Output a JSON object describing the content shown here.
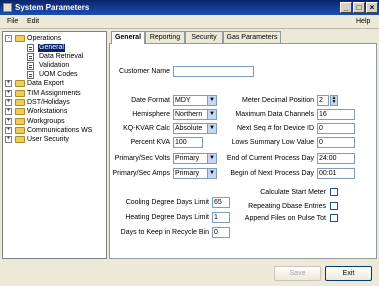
{
  "window": {
    "title": "System Parameters",
    "controls": {
      "minimize": "_",
      "maximize": "□",
      "close": "×"
    }
  },
  "menu": {
    "file": "File",
    "edit": "Edit",
    "help": "Help"
  },
  "tree": {
    "items": [
      {
        "label": "Operations",
        "expander": "-"
      },
      {
        "label": "General",
        "selected": true
      },
      {
        "label": "Data Retrieval"
      },
      {
        "label": "Validation"
      },
      {
        "label": "UOM Codes"
      },
      {
        "label": "Data Export",
        "expander": "+"
      },
      {
        "label": "TIM Assignments",
        "expander": "+"
      },
      {
        "label": "DST/Holidays",
        "expander": "+"
      },
      {
        "label": "Workstations",
        "expander": "+"
      },
      {
        "label": "Workgroups",
        "expander": "+"
      },
      {
        "label": "Communications WS",
        "expander": "+"
      },
      {
        "label": "User Security",
        "expander": "+"
      }
    ]
  },
  "tabs": [
    {
      "label": "General",
      "active": true
    },
    {
      "label": "Reporting"
    },
    {
      "label": "Security"
    },
    {
      "label": "Gas Parameters"
    }
  ],
  "form": {
    "customer_name": {
      "label": "Customer Name",
      "value": ""
    },
    "date_format": {
      "label": "Date Format",
      "value": "MDY"
    },
    "hemisphere": {
      "label": "Hemisphere",
      "value": "Northern"
    },
    "kq_kvar_calc": {
      "label": "KQ-KVAR Calc",
      "value": "Absolute"
    },
    "percent_kva": {
      "label": "Percent KVA",
      "value": "100"
    },
    "primary_sec_volts": {
      "label": "Primary/Sec Volts",
      "value": "Primary"
    },
    "primary_sec_amps": {
      "label": "Primary/Sec Amps",
      "value": "Primary"
    },
    "meter_decimal_position": {
      "label": "Meter Decimal Position",
      "value": "2"
    },
    "max_data_channels": {
      "label": "Maximum Data Channels",
      "value": "16"
    },
    "next_seq": {
      "label": "Next Seq # for Device ID",
      "value": "0"
    },
    "lows_summary": {
      "label": "Lows Summary Low Value",
      "value": "0"
    },
    "end_current_day": {
      "label": "End of Current Process Day",
      "value": "24:00"
    },
    "begin_next_day": {
      "label": "Begin of Next Process Day",
      "value": "00:01"
    },
    "cooling_degree": {
      "label": "Cooling Degree Days Limit",
      "value": "65"
    },
    "heating_degree": {
      "label": "Heating Degree Days Limit",
      "value": "1"
    },
    "recycle_bin": {
      "label": "Days to Keep in Recycle Bin",
      "value": "0"
    },
    "calculate_start_meter": {
      "label": "Calculate Start Meter",
      "checked": false
    },
    "repeating_dbase": {
      "label": "Repeating Dbase Entries",
      "checked": false
    },
    "append_files": {
      "label": "Append Files on Pulse Tot",
      "checked": false
    }
  },
  "buttons": {
    "save": "Save",
    "exit": "Exit"
  }
}
